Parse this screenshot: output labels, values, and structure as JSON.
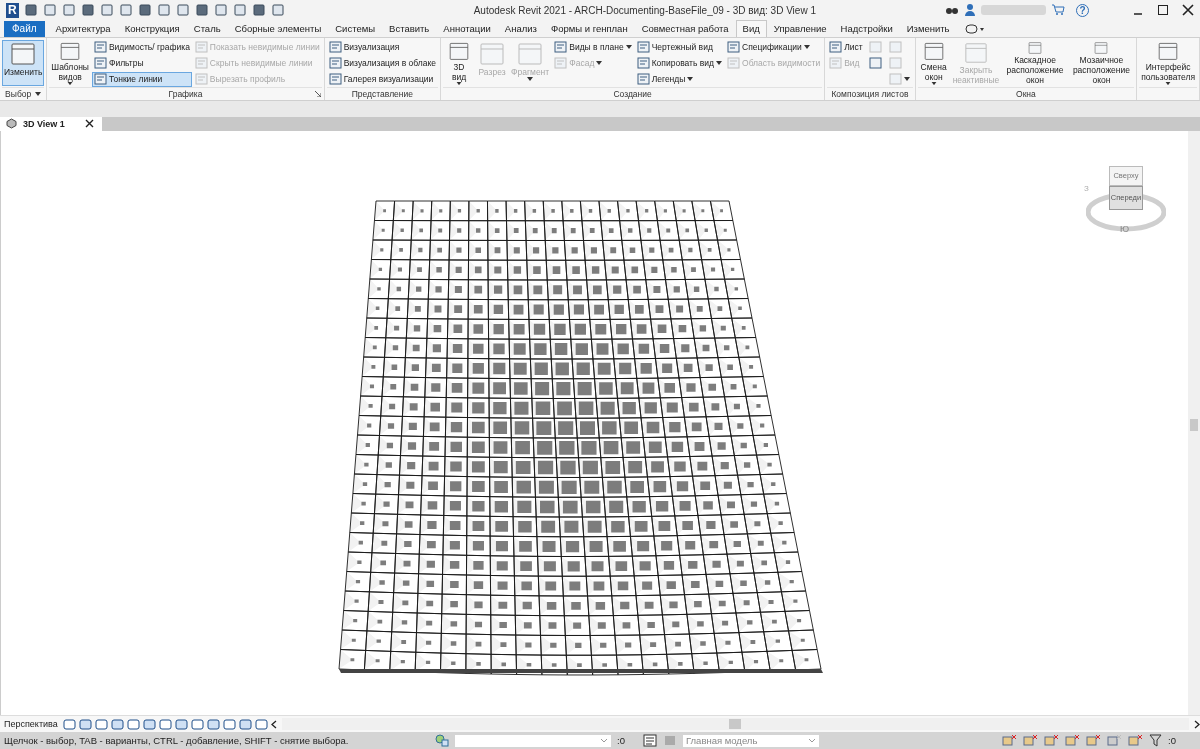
{
  "title_bar": {
    "logo": "R",
    "title": "Autodesk Revit 2021 - ARCH-Documenting-BaseFile_09 - 3D вид: 3D View 1",
    "help": "?"
  },
  "menu": {
    "file": "Файл",
    "tabs": [
      {
        "label": "Архитектура",
        "selected": false
      },
      {
        "label": "Конструкция",
        "selected": false
      },
      {
        "label": "Сталь",
        "selected": false
      },
      {
        "label": "Сборные элементы",
        "selected": false
      },
      {
        "label": "Системы",
        "selected": false
      },
      {
        "label": "Вставить",
        "selected": false
      },
      {
        "label": "Аннотации",
        "selected": false
      },
      {
        "label": "Анализ",
        "selected": false
      },
      {
        "label": "Формы и генплан",
        "selected": false
      },
      {
        "label": "Совместная работа",
        "selected": false
      },
      {
        "label": "Вид",
        "selected": true
      },
      {
        "label": "Управление",
        "selected": false
      },
      {
        "label": "Надстройки",
        "selected": false
      },
      {
        "label": "Изменить",
        "selected": false
      }
    ]
  },
  "ribbon": [
    {
      "label": "Выбор",
      "dropdown": true,
      "launcher": false,
      "columns": [
        [
          {
            "kind": "large",
            "label": "Изменить",
            "selected": true,
            "disabled": false,
            "dropdown": false
          }
        ]
      ]
    },
    {
      "label": "Графика",
      "dropdown": false,
      "launcher": true,
      "columns": [
        [
          {
            "kind": "large",
            "label": "Шаблоны\nвидов",
            "selected": false,
            "disabled": false,
            "dropdown": true
          }
        ],
        [
          {
            "kind": "small",
            "label": "Видимость/ графика",
            "selected": false,
            "disabled": false,
            "dropdown": false
          },
          {
            "kind": "small",
            "label": "Фильтры",
            "selected": false,
            "disabled": false,
            "dropdown": false
          },
          {
            "kind": "small",
            "label": "Тонкие линии",
            "selected": true,
            "disabled": false,
            "dropdown": false
          }
        ],
        [
          {
            "kind": "small",
            "label": "Показать невидимые линии",
            "selected": false,
            "disabled": true,
            "dropdown": false
          },
          {
            "kind": "small",
            "label": "Скрыть невидимые линии",
            "selected": false,
            "disabled": true,
            "dropdown": false
          },
          {
            "kind": "small",
            "label": "Вырезать профиль",
            "selected": false,
            "disabled": true,
            "dropdown": false
          }
        ]
      ]
    },
    {
      "label": "Представление",
      "dropdown": false,
      "launcher": false,
      "columns": [
        [
          {
            "kind": "small",
            "label": "Визуализация",
            "selected": false,
            "disabled": false,
            "dropdown": false
          },
          {
            "kind": "small",
            "label": "Визуализация  в облаке",
            "selected": false,
            "disabled": false,
            "dropdown": false
          },
          {
            "kind": "small",
            "label": "Галерея  визуализации",
            "selected": false,
            "disabled": false,
            "dropdown": false
          }
        ]
      ]
    },
    {
      "label": "Создание",
      "dropdown": false,
      "launcher": false,
      "columns": [
        [
          {
            "kind": "large",
            "label": "3D\nвид",
            "selected": false,
            "disabled": false,
            "dropdown": true
          }
        ],
        [
          {
            "kind": "large",
            "label": "Разрез",
            "selected": false,
            "disabled": true,
            "dropdown": false
          }
        ],
        [
          {
            "kind": "large",
            "label": "Фрагмент",
            "selected": false,
            "disabled": true,
            "dropdown": true
          }
        ],
        [
          {
            "kind": "small",
            "label": "Виды в плане",
            "selected": false,
            "disabled": false,
            "dropdown": true
          },
          {
            "kind": "small",
            "label": "Фасад",
            "selected": false,
            "disabled": true,
            "dropdown": true
          }
        ],
        [
          {
            "kind": "small",
            "label": "Чертежный вид",
            "selected": false,
            "disabled": false,
            "dropdown": false
          },
          {
            "kind": "small",
            "label": "Копировать вид",
            "selected": false,
            "disabled": false,
            "dropdown": true
          },
          {
            "kind": "small",
            "label": "Легенды",
            "selected": false,
            "disabled": false,
            "dropdown": true
          }
        ],
        [
          {
            "kind": "small",
            "label": "Спецификации",
            "selected": false,
            "disabled": false,
            "dropdown": true
          },
          {
            "kind": "small",
            "label": "Область видимости",
            "selected": false,
            "disabled": true,
            "dropdown": false
          }
        ]
      ]
    },
    {
      "label": "Композиция листов",
      "dropdown": false,
      "launcher": false,
      "columns": [
        [
          {
            "kind": "small",
            "label": "Лист",
            "selected": false,
            "disabled": false,
            "dropdown": false
          },
          {
            "kind": "small",
            "label": "Вид",
            "selected": false,
            "disabled": true,
            "dropdown": false
          }
        ],
        [
          {
            "kind": "icon",
            "selected": false,
            "disabled": true,
            "dropdown": false
          },
          {
            "kind": "icon",
            "selected": false,
            "disabled": false,
            "dropdown": false
          }
        ],
        [
          {
            "kind": "icon",
            "selected": false,
            "disabled": true,
            "dropdown": false
          },
          {
            "kind": "icon",
            "selected": false,
            "disabled": true,
            "dropdown": false
          },
          {
            "kind": "icon",
            "selected": false,
            "disabled": true,
            "dropdown": true
          }
        ]
      ]
    },
    {
      "label": "Окна",
      "dropdown": false,
      "launcher": false,
      "columns": [
        [
          {
            "kind": "large",
            "label": "Смена\nокон",
            "selected": false,
            "disabled": false,
            "dropdown": true
          }
        ],
        [
          {
            "kind": "large",
            "label": "Закрыть\nнеактивные",
            "selected": false,
            "disabled": true,
            "dropdown": false
          }
        ],
        [
          {
            "kind": "large",
            "label": "Каскадное\nрасположение окон",
            "selected": false,
            "disabled": false,
            "dropdown": false
          }
        ],
        [
          {
            "kind": "large",
            "label": "Мозаичное\nрасположение окон",
            "selected": false,
            "disabled": false,
            "dropdown": false
          }
        ]
      ]
    },
    {
      "dropdown": false,
      "launcher": false,
      "columns": [
        [
          {
            "kind": "large",
            "label": "Интерфейс\nпользователя",
            "selected": false,
            "disabled": false,
            "dropdown": true
          }
        ]
      ]
    }
  ],
  "view_tab": {
    "label": "3D View 1"
  },
  "viewcube": {
    "top": "Сверху",
    "front": "Спереди",
    "south": "Ю",
    "west": "З"
  },
  "view_bar": {
    "label": "Перспектива"
  },
  "status_bar": {
    "hint": "Щелчок - выбор, TAB - варианты, CTRL - добавление, SHIFT - снятие выбора.",
    "count": ":0",
    "model": "Главная модель",
    "filter_count": ":0"
  }
}
